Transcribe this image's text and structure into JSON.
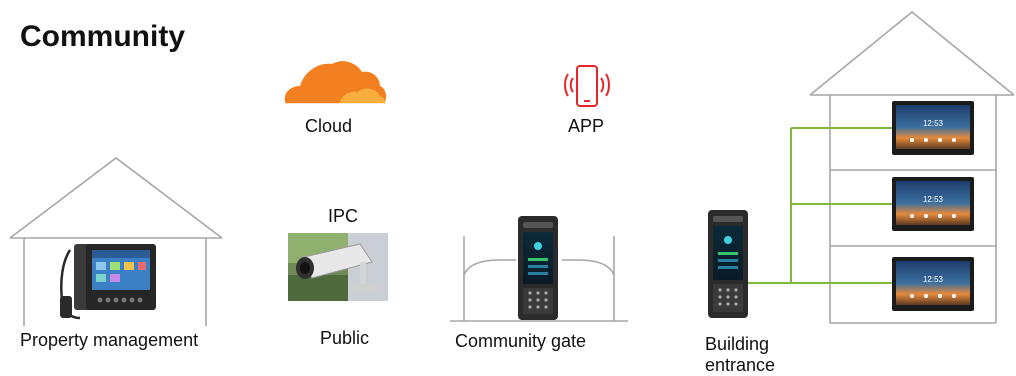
{
  "title": "Community",
  "labels": {
    "cloud": "Cloud",
    "app": "APP",
    "ipc": "IPC",
    "public": "Public",
    "property_management": "Property management",
    "community_gate": "Community gate",
    "building_entrance_line1": "Building",
    "building_entrance_line2": "entrance"
  },
  "screens": {
    "time": "12:53"
  },
  "colors": {
    "cloud": "#f38020",
    "phone": "#e8262a",
    "connection": "#7dba3c",
    "outline": "#a6a6a6"
  },
  "icons": [
    "cloud-icon",
    "smartphone-icon",
    "ip-camera-icon",
    "desk-phone-icon",
    "door-station-icon",
    "indoor-monitor-icon"
  ]
}
